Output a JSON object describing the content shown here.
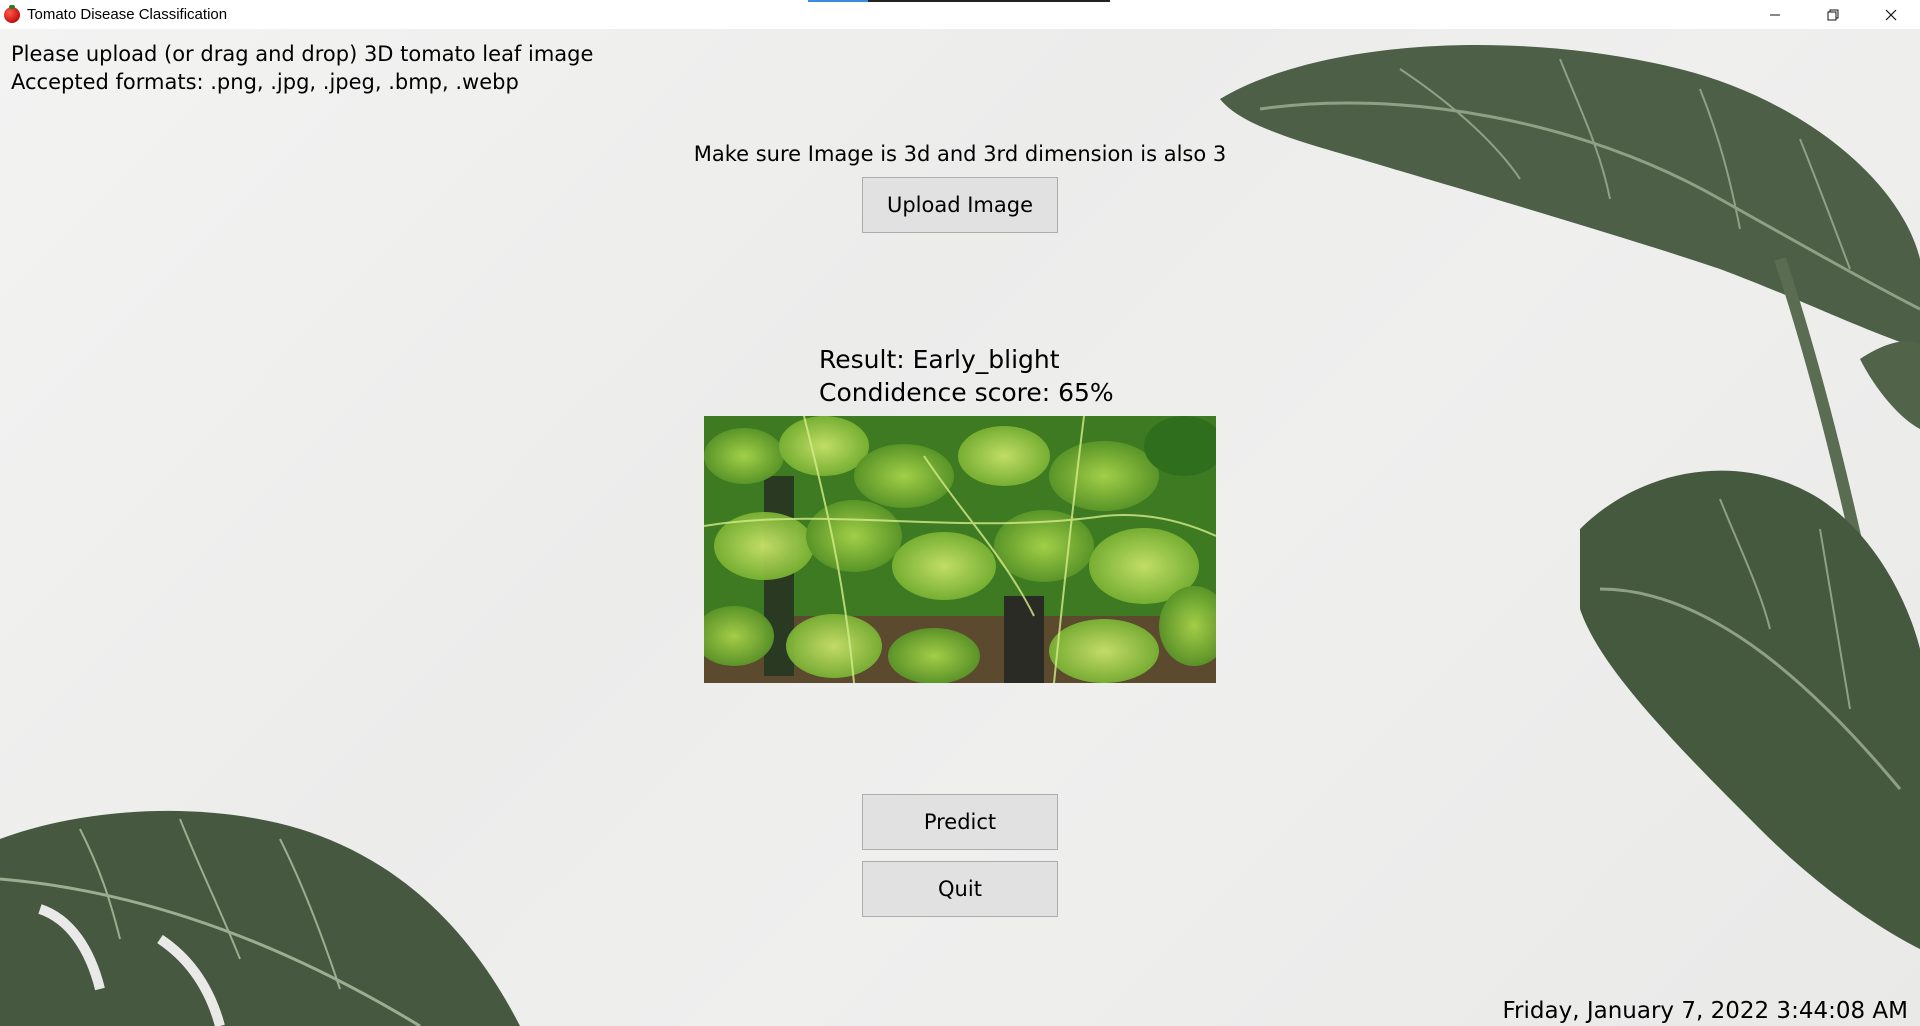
{
  "window": {
    "title": "Tomato Disease Classification",
    "controls": {
      "minimize": "minimize-icon",
      "restore": "restore-icon",
      "close": "close-icon"
    }
  },
  "instructions": {
    "line1": "Please upload (or drag and drop) 3D tomato leaf image",
    "line2": "Accepted formats: .png, .jpg, .jpeg, .bmp, .webp"
  },
  "note": "Make sure Image is 3d and 3rd dimension is also 3",
  "buttons": {
    "upload": "Upload Image",
    "predict": "Predict",
    "quit": "Quit"
  },
  "result": {
    "line1": "Result: Early_blight",
    "line2": "Condidence score: 65%"
  },
  "footer": {
    "datetime": "Friday, January 7, 2022 3:44:08 AM"
  },
  "colors": {
    "button_bg": "#e1e1e1",
    "button_border": "#adadad",
    "background": "#efefee",
    "app_icon": "#d81f1f"
  }
}
